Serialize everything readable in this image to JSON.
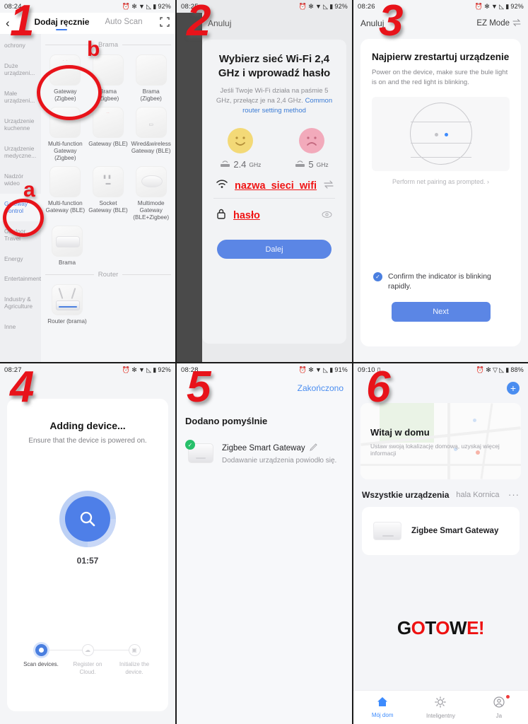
{
  "panels": {
    "p1": {
      "status": {
        "time": "08:24",
        "battery": "92%"
      },
      "topbar": {
        "back_icon": "chevron-left-icon",
        "tab_manual": "Dodaj ręcznie",
        "tab_autoscan": "Auto Scan",
        "scan_icon": "qr-scan-icon"
      },
      "sidebar": [
        {
          "label": "ochrony",
          "active": false
        },
        {
          "label": "Duże urządzeni...",
          "active": false
        },
        {
          "label": "Małe urządzeni...",
          "active": false
        },
        {
          "label": "Urządzenie kuchenne",
          "active": false
        },
        {
          "label": "Urządzenie medyczne...",
          "active": false
        },
        {
          "label": "Nadzór wideo",
          "active": false
        },
        {
          "label": "Gateway Control",
          "active": true
        },
        {
          "label": "Outdoor Travel",
          "active": false
        },
        {
          "label": "Energy",
          "active": false
        },
        {
          "label": "Entertainment",
          "active": false
        },
        {
          "label": "Industry & Agriculture",
          "active": false
        },
        {
          "label": "Inne",
          "active": false
        }
      ],
      "section_gateway": "Brama",
      "section_router": "Router",
      "devices": [
        {
          "name": "Gateway\n(Zigbee)",
          "icon": "gateway-square-icon"
        },
        {
          "name": "Brama\n(Zigbee)",
          "icon": "gateway-square-icon"
        },
        {
          "name": "Brama\n(Zigbee)",
          "icon": "gateway-square-icon"
        },
        {
          "name": "Multi-function Gateway\n(Zigbee)",
          "icon": "gateway-square-icon"
        },
        {
          "name": "Gateway\n(BLE)",
          "icon": "gateway-ble-icon"
        },
        {
          "name": "Wired&wireless Gateway\n(BLE)",
          "icon": "gateway-wired-icon"
        },
        {
          "name": "Multi-function Gateway\n(BLE)",
          "icon": "gateway-square-icon"
        },
        {
          "name": "Socket Gateway\n(BLE)",
          "icon": "socket-gateway-icon"
        },
        {
          "name": "Multimode Gateway\n(BLE+Zigbee)",
          "icon": "puck-gateway-icon"
        },
        {
          "name": "Brama",
          "icon": "box-gateway-icon"
        }
      ],
      "routers": [
        {
          "name": "Router\n(brama)",
          "icon": "router-icon"
        }
      ],
      "markers": {
        "step": "1",
        "letter_b": "b",
        "letter_a": "a"
      }
    },
    "p2": {
      "status": {
        "time": "08:25",
        "battery": "92%"
      },
      "cancel": "Anuluj",
      "title": "Wybierz sieć Wi-Fi 2,4 GHz i wprowadź hasło",
      "subtitle": "Jeśli Twoje Wi-Fi działa na paśmie 5 GHz, przełącz je na 2,4 GHz. ",
      "link": "Common router setting method",
      "freq_good": "2.4",
      "freq_good_unit": "GHz",
      "freq_bad": "5",
      "freq_bad_unit": "GHz",
      "ssid_value": "nazwa_sieci_wifi",
      "password_value": "hasło",
      "wifi_icon": "wifi-icon",
      "lock_icon": "lock-icon",
      "swap_icon": "switch-network-icon",
      "eye_icon": "eye-icon",
      "next_button": "Dalej",
      "marker_step": "2"
    },
    "p3": {
      "status": {
        "time": "08:26",
        "battery": "92%"
      },
      "cancel": "Anuluj",
      "mode": "EZ Mode",
      "mode_icon": "swap-mode-icon",
      "title": "Najpierw zrestartuj urządzenie",
      "body": "Power on the device, make sure the bule light is on and the red light is blinking.",
      "hint": "Perform net pairing as prompted.",
      "hint_chevron": "chevron-right-icon",
      "confirm": "Confirm the indicator is blinking rapidly.",
      "next_button": "Next",
      "marker_step": "3"
    },
    "p4": {
      "status": {
        "time": "08:27",
        "battery": "92%"
      },
      "title": "Adding device...",
      "subtitle": "Ensure that the device is powered on.",
      "timer": "01:57",
      "search_icon": "magnifier-icon",
      "steps": [
        {
          "label": "Scan devices.",
          "active": true,
          "icon": "radio-filled-icon"
        },
        {
          "label": "Register on Cloud.",
          "active": false,
          "icon": "cloud-icon"
        },
        {
          "label": "Initialize the device.",
          "active": false,
          "icon": "device-icon"
        }
      ],
      "marker_step": "4"
    },
    "p5": {
      "status": {
        "time": "08:28",
        "battery": "91%"
      },
      "done": "Zakończono",
      "title": "Dodano pomyślnie",
      "device_name": "Zigbee Smart Gateway",
      "device_status": "Dodawanie urządzenia powiodło się.",
      "edit_icon": "pencil-icon",
      "check_icon": "check-circle-icon",
      "marker_step": "5"
    },
    "p6": {
      "status": {
        "time": "09:10",
        "battery": "88%"
      },
      "add_icon": "plus-circle-icon",
      "hero_title": "Witaj w domu",
      "hero_subtitle": "Ustaw swoją lokalizację domową, uzyskaj więcej informacji",
      "section_title": "Wszystkie urządzenia",
      "section_room": "hala Kornica",
      "more_icon": "more-dots-icon",
      "device_name": "Zigbee Smart Gateway",
      "gotowe": [
        {
          "ch": "G",
          "color": "#121212"
        },
        {
          "ch": "O",
          "color": "#ee1111"
        },
        {
          "ch": "T",
          "color": "#121212"
        },
        {
          "ch": "O",
          "color": "#ee1111"
        },
        {
          "ch": "W",
          "color": "#121212"
        },
        {
          "ch": "E",
          "color": "#ee1111"
        },
        {
          "ch": "!",
          "color": "#ee1111"
        }
      ],
      "nav": [
        {
          "label": "Mój dom",
          "icon": "home-icon",
          "active": true
        },
        {
          "label": "Inteligentny",
          "icon": "sun-icon",
          "active": false
        },
        {
          "label": "Ja",
          "icon": "profile-icon",
          "active": false
        }
      ],
      "marker_step": "6"
    }
  },
  "colors": {
    "accent_blue": "#4a7fe0",
    "marker_red": "#e8131a",
    "link_blue": "#3a7bd5",
    "success_green": "#27c06a"
  }
}
